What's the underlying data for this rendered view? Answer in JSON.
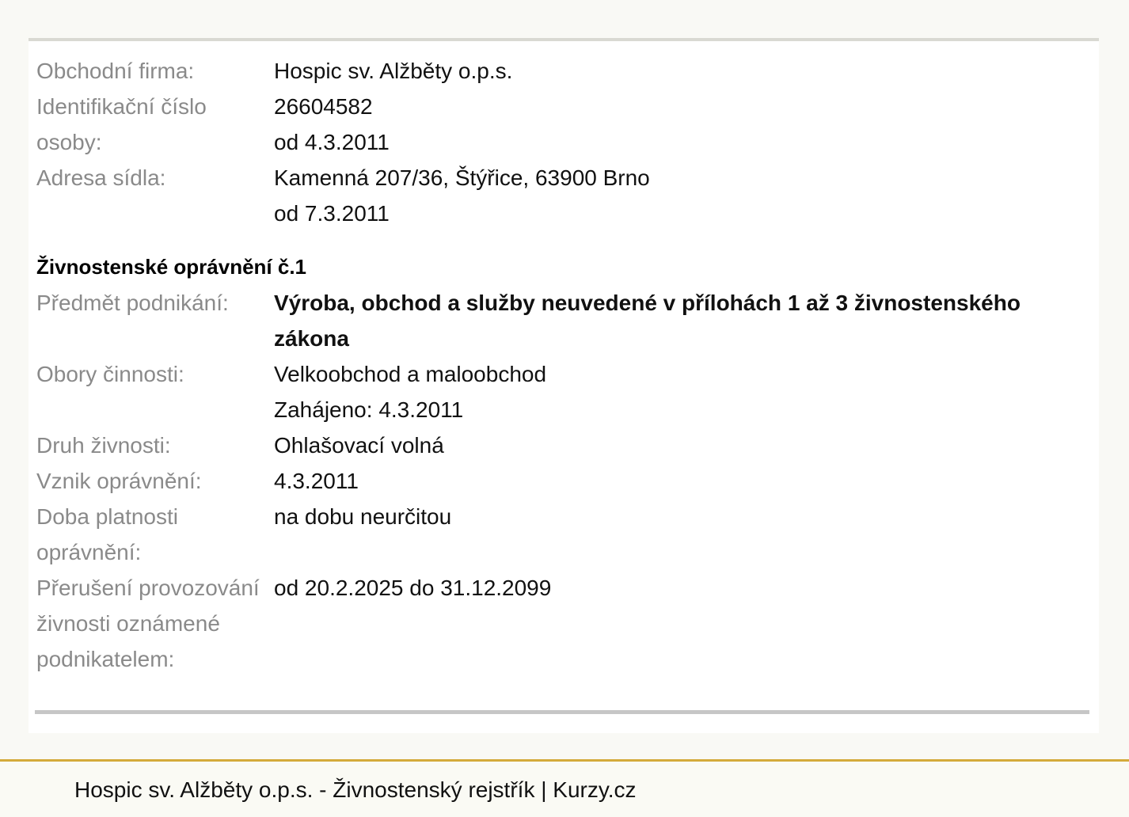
{
  "company": {
    "name_label": "Obchodní firma:",
    "name_value": "Hospic sv. Alžběty o.p.s.",
    "id_label": "Identifikační číslo osoby:",
    "id_value": "26604582",
    "id_since": "od 4.3.2011",
    "address_label": "Adresa sídla:",
    "address_value": "Kamenná 207/36, Štýřice, 63900 Brno",
    "address_since": "od 7.3.2011"
  },
  "license": {
    "title": "Živnostenské oprávnění č.1",
    "subject_label": "Předmět podnikání:",
    "subject_value": "Výroba, obchod a služby neuvedené v přílohách 1 až 3 živnostenského zákona",
    "fields_label": "Obory činnosti:",
    "fields_value": "Velkoobchod a maloobchod",
    "fields_started": "Zahájeno: 4.3.2011",
    "type_label": "Druh živnosti:",
    "type_value": "Ohlašovací volná",
    "origin_label": "Vznik oprávnění:",
    "origin_value": "4.3.2011",
    "validity_label": "Doba platnosti oprávnění:",
    "validity_value": "na dobu neurčitou",
    "interruption_label": "Přerušení provozování živnosti oznámené podnikatelem:",
    "interruption_value": "od 20.2.2025 do 31.12.2099"
  },
  "footer": {
    "text": "Hospic sv. Alžběty o.p.s. - Živnostenský rejstřík | Kurzy.cz"
  },
  "colors": {
    "label": "#8a8a8a",
    "value": "#111111",
    "footer_accent": "#d4aa3b",
    "background": "#f9f9f5"
  }
}
